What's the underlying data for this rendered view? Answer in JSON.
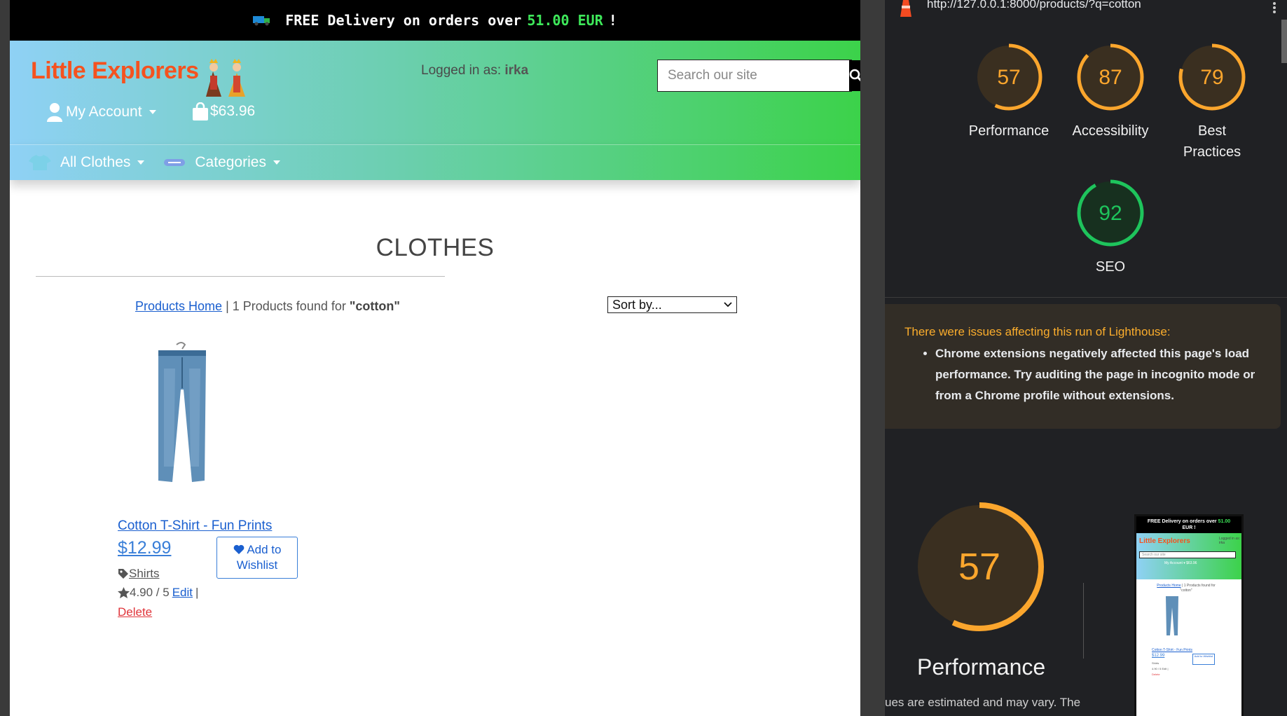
{
  "promo": {
    "prefix": "FREE Delivery on orders over",
    "amount": "51.00 EUR",
    "suffix": "!"
  },
  "header": {
    "brand": "Little Explorers",
    "logged_in_label": "Logged in as:",
    "logged_in_user": "irka",
    "search_placeholder": "Search our site",
    "account_label": "My Account",
    "cart_total": "$63.96"
  },
  "nav": {
    "items": [
      {
        "label": "All Clothes",
        "icon": "tshirt-icon"
      },
      {
        "label": "Categories",
        "icon": "category-icon"
      }
    ]
  },
  "main": {
    "title": "CLOTHES",
    "breadcrumb_link": "Products Home",
    "results_text": "| 1 Products found for",
    "query": "\"cotton\"",
    "sort_label": "Sort by..."
  },
  "product": {
    "name": "Cotton T-Shirt - Fun Prints",
    "price": "$12.99",
    "wishlist_line1": "Add to",
    "wishlist_line2": "Wishlist",
    "category": "Shirts",
    "rating": "4.90 / 5",
    "edit": "Edit",
    "separator": "|",
    "delete": "Delete"
  },
  "lighthouse": {
    "url": "http://127.0.0.1:8000/products/?q=cotton",
    "scores": [
      {
        "value": 57,
        "label_lines": [
          "Performance"
        ],
        "color": "#fba62d"
      },
      {
        "value": 87,
        "label_lines": [
          "Accessibility"
        ],
        "color": "#fba62d"
      },
      {
        "value": 79,
        "label_lines": [
          "Best",
          "Practices"
        ],
        "color": "#fba62d"
      },
      {
        "value": 92,
        "label_lines": [
          "SEO"
        ],
        "color": "#1ec45c"
      }
    ],
    "warning_title": "There were issues affecting this run of Lighthouse:",
    "warning_item": "Chrome extensions negatively affected this page's load performance. Try auditing the page in incognito mode or from a Chrome profile without extensions.",
    "big_score": {
      "value": 57,
      "label": "Performance",
      "color": "#fba62d"
    },
    "note": "ues are estimated and may vary. The",
    "thumb": {
      "promo": "FREE Delivery on orders over",
      "amount": "51.00",
      "promo_end": "EUR !",
      "brand": "Little Explorers",
      "logged": "Logged in as: irka",
      "search": "Search our site",
      "account": "My Account ▾   $63.96",
      "results_link": "Products Home",
      "results_text": "| 1 Products found for \"cotton\"",
      "name": "Cotton T-Shirt - Fun Prints",
      "price": "$12.99",
      "wishlist": "Add to Wishlist",
      "category": "Shirts",
      "rating": "4.90 / 5 Edit |",
      "delete": "Delete"
    }
  }
}
